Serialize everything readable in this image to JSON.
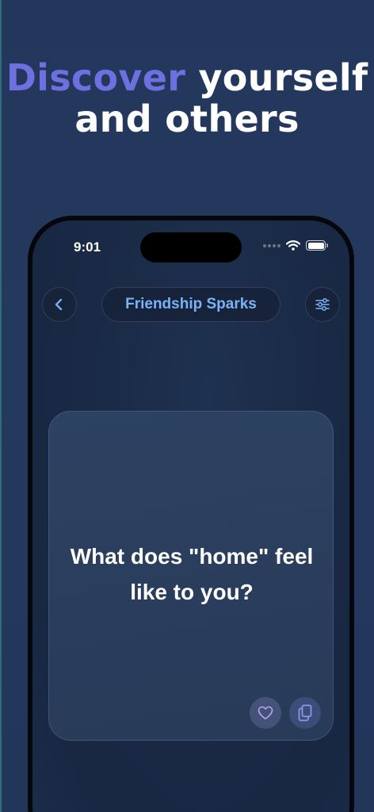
{
  "headline": {
    "accent": "Discover",
    "rest_line1": " yourself",
    "line2": "and others"
  },
  "status_bar": {
    "time": "9:01"
  },
  "header": {
    "title": "Friendship Sparks"
  },
  "card": {
    "question": "What does \"home\" feel like to you?"
  },
  "icons": {
    "back": "chevron-left-icon",
    "filter": "sliders-icon",
    "heart": "heart-icon",
    "copy": "copy-icon",
    "wifi": "wifi-icon",
    "battery": "battery-icon"
  },
  "colors": {
    "background": "#23375c",
    "accent": "#6e70e0",
    "title": "#7ab3f5",
    "card": "#2b3f5e"
  }
}
